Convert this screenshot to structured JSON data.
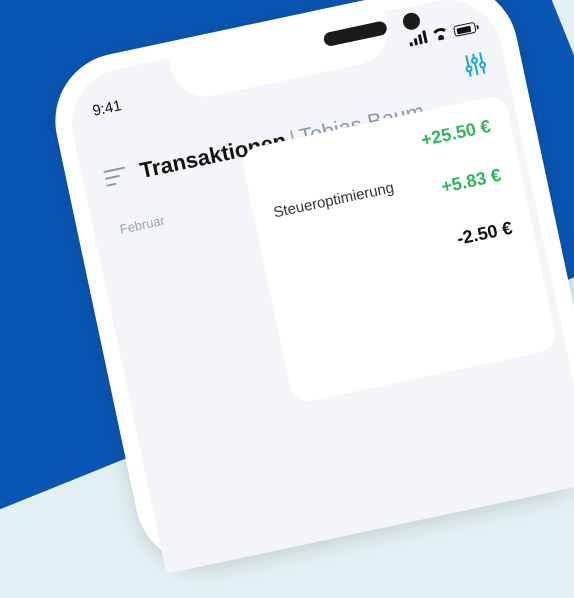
{
  "status_bar": {
    "time": "9:41"
  },
  "header": {
    "title": "Transaktionen",
    "separator": "|",
    "user": "Tobias Baum"
  },
  "transactions": [
    {
      "amount": "+25.50 €",
      "color": "#2eb85c"
    },
    {
      "amount": "+5.83 €",
      "color": "#2eb85c"
    },
    {
      "amount": "-2.50 €",
      "color": "#111111"
    }
  ],
  "group": {
    "month": "Februar"
  },
  "visible_item": {
    "label": "Steueroptimierung"
  },
  "colors": {
    "background_blue": "#0a56b4",
    "accent_teal": "#1aa7c9",
    "positive_green": "#2eb85c"
  }
}
